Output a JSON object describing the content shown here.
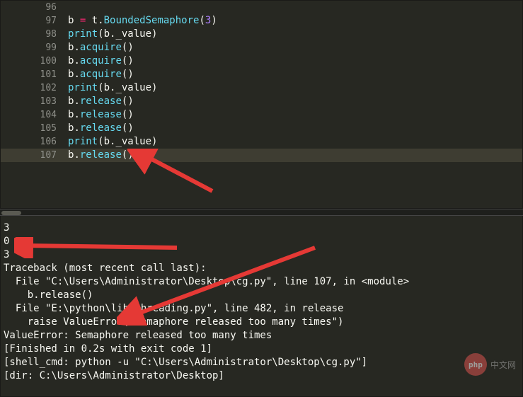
{
  "editor": {
    "lines": [
      {
        "num": "96",
        "tokens": []
      },
      {
        "num": "97",
        "tokens": [
          {
            "t": "b ",
            "c": "tok-var"
          },
          {
            "t": "=",
            "c": "tok-op"
          },
          {
            "t": " t",
            "c": "tok-var"
          },
          {
            "t": ".",
            "c": "tok-punct"
          },
          {
            "t": "BoundedSemaphore",
            "c": "tok-call"
          },
          {
            "t": "(",
            "c": "tok-punct"
          },
          {
            "t": "3",
            "c": "tok-num"
          },
          {
            "t": ")",
            "c": "tok-punct"
          }
        ]
      },
      {
        "num": "98",
        "tokens": [
          {
            "t": "print",
            "c": "tok-call"
          },
          {
            "t": "(b",
            "c": "tok-punct"
          },
          {
            "t": ".",
            "c": "tok-punct"
          },
          {
            "t": "_value)",
            "c": "tok-var"
          }
        ]
      },
      {
        "num": "99",
        "tokens": [
          {
            "t": "b",
            "c": "tok-var"
          },
          {
            "t": ".",
            "c": "tok-punct"
          },
          {
            "t": "acquire",
            "c": "tok-call"
          },
          {
            "t": "()",
            "c": "tok-punct"
          }
        ]
      },
      {
        "num": "100",
        "tokens": [
          {
            "t": "b",
            "c": "tok-var"
          },
          {
            "t": ".",
            "c": "tok-punct"
          },
          {
            "t": "acquire",
            "c": "tok-call"
          },
          {
            "t": "()",
            "c": "tok-punct"
          }
        ]
      },
      {
        "num": "101",
        "tokens": [
          {
            "t": "b",
            "c": "tok-var"
          },
          {
            "t": ".",
            "c": "tok-punct"
          },
          {
            "t": "acquire",
            "c": "tok-call"
          },
          {
            "t": "()",
            "c": "tok-punct"
          }
        ]
      },
      {
        "num": "102",
        "tokens": [
          {
            "t": "print",
            "c": "tok-call"
          },
          {
            "t": "(b",
            "c": "tok-punct"
          },
          {
            "t": ".",
            "c": "tok-punct"
          },
          {
            "t": "_value)",
            "c": "tok-var"
          }
        ]
      },
      {
        "num": "103",
        "tokens": [
          {
            "t": "b",
            "c": "tok-var"
          },
          {
            "t": ".",
            "c": "tok-punct"
          },
          {
            "t": "release",
            "c": "tok-call"
          },
          {
            "t": "()",
            "c": "tok-punct"
          }
        ]
      },
      {
        "num": "104",
        "tokens": [
          {
            "t": "b",
            "c": "tok-var"
          },
          {
            "t": ".",
            "c": "tok-punct"
          },
          {
            "t": "release",
            "c": "tok-call"
          },
          {
            "t": "()",
            "c": "tok-punct"
          }
        ]
      },
      {
        "num": "105",
        "tokens": [
          {
            "t": "b",
            "c": "tok-var"
          },
          {
            "t": ".",
            "c": "tok-punct"
          },
          {
            "t": "release",
            "c": "tok-call"
          },
          {
            "t": "()",
            "c": "tok-punct"
          }
        ]
      },
      {
        "num": "106",
        "tokens": [
          {
            "t": "print",
            "c": "tok-call"
          },
          {
            "t": "(b",
            "c": "tok-punct"
          },
          {
            "t": ".",
            "c": "tok-punct"
          },
          {
            "t": "_value)",
            "c": "tok-var"
          }
        ]
      },
      {
        "num": "107",
        "highlighted": true,
        "tokens": [
          {
            "t": "b",
            "c": "tok-var"
          },
          {
            "t": ".",
            "c": "tok-punct"
          },
          {
            "t": "release",
            "c": "tok-call"
          },
          {
            "t": "()",
            "c": "tok-punct"
          }
        ]
      }
    ]
  },
  "terminal": {
    "lines": [
      "3",
      "0",
      "3",
      "Traceback (most recent call last):",
      "  File \"C:\\Users\\Administrator\\Desktop\\cg.py\", line 107, in <module>",
      "    b.release()",
      "  File \"E:\\python\\lib\\threading.py\", line 482, in release",
      "    raise ValueError(\"Semaphore released too many times\")",
      "ValueError: Semaphore released too many times",
      "[Finished in 0.2s with exit code 1]",
      "[shell_cmd: python -u \"C:\\Users\\Administrator\\Desktop\\cg.py\"]",
      "[dir: C:\\Users\\Administrator\\Desktop]"
    ]
  },
  "watermark": {
    "badge": "php",
    "text": "中文网"
  },
  "annotation_color": "#e53935"
}
